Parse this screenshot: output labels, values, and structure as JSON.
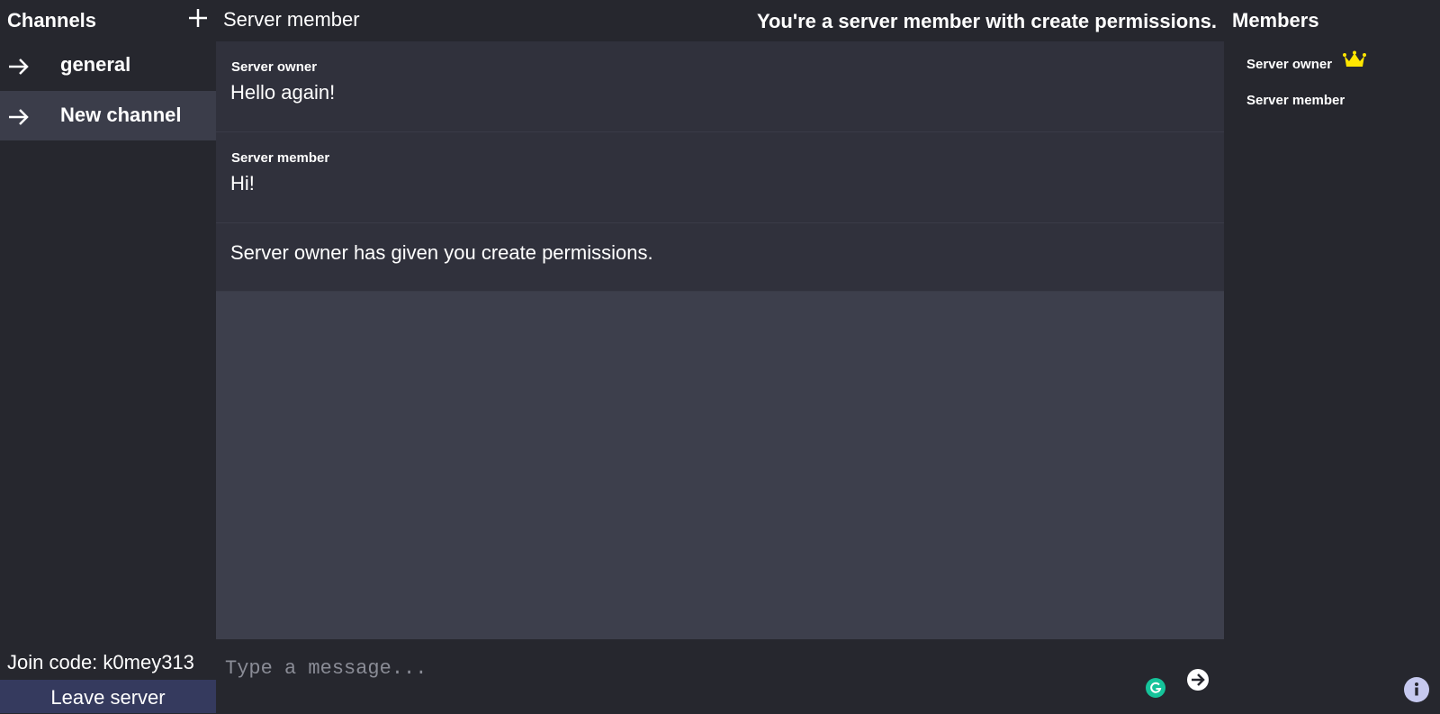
{
  "sidebar": {
    "title": "Channels",
    "channels": [
      {
        "label": "general",
        "active": false
      },
      {
        "label": "New channel",
        "active": true
      }
    ],
    "join_code": "Join code: k0mey313",
    "leave_label": "Leave server"
  },
  "topbar": {
    "current_user": "Server member",
    "permission_status": "You're a server member with create permissions."
  },
  "messages": [
    {
      "author": "Server owner",
      "text": "Hello again!"
    },
    {
      "author": "Server member",
      "text": "Hi!"
    },
    {
      "author": "",
      "text": "Server owner has given you create permissions."
    }
  ],
  "composer": {
    "placeholder": "Type a message..."
  },
  "members": {
    "title": "Members",
    "list": [
      {
        "name": "Server owner",
        "icon": "crown-icon"
      },
      {
        "name": "Server member"
      }
    ]
  },
  "colors": {
    "background": "#26272e",
    "chat_background": "#3d3f4c",
    "message_background": "#30313c",
    "active_channel": "#3b3d4a",
    "leave_button": "#353a5e",
    "crown": "#ffe600",
    "grammarly": "#15c39a",
    "info_button": "#c6c9ef"
  },
  "icons": [
    "plus-icon",
    "arrow-right-icon",
    "crown-icon",
    "grammarly-icon",
    "send-icon",
    "info-icon"
  ]
}
